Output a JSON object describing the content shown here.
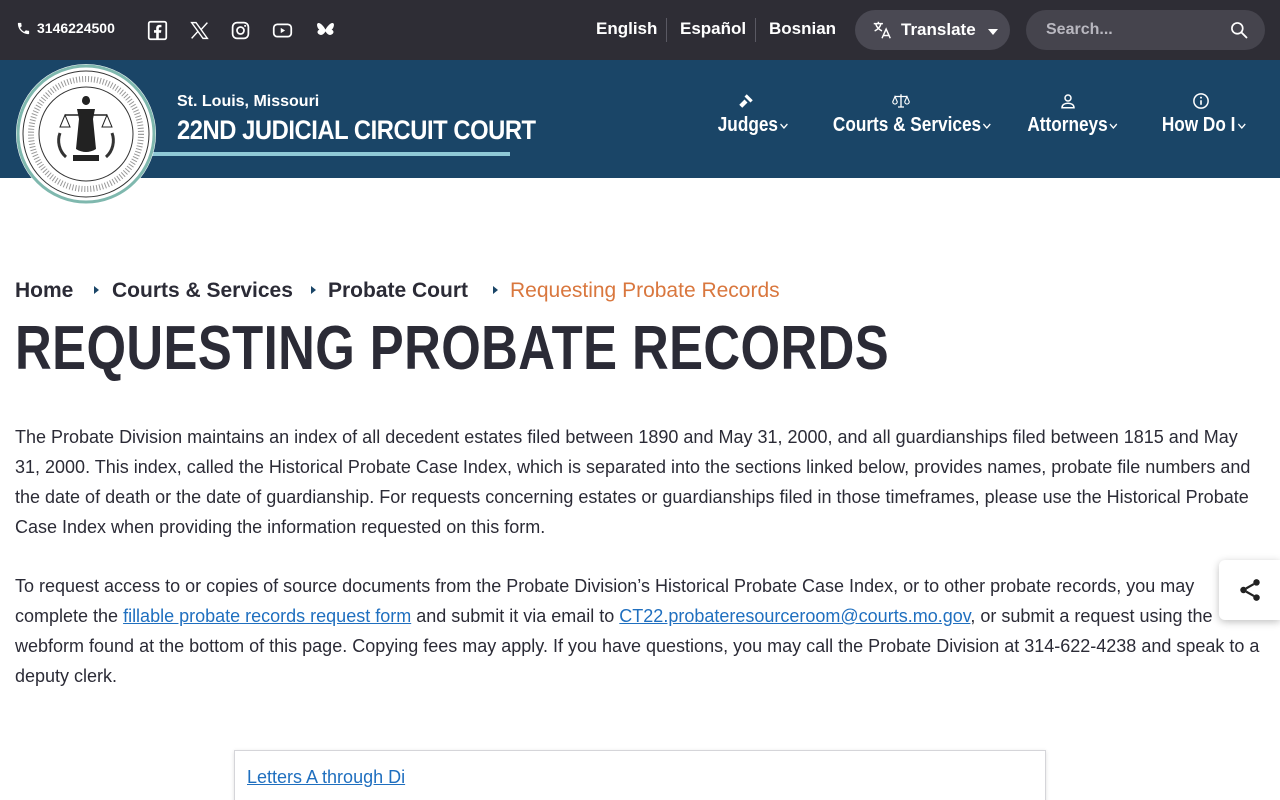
{
  "topbar": {
    "phone": "3146224500",
    "social": [
      "facebook-icon",
      "x-icon",
      "instagram-icon",
      "youtube-icon",
      "bluesky-icon"
    ],
    "languages": [
      "English",
      "Español",
      "Bosnian"
    ],
    "translate_label": "Translate",
    "search_placeholder": "Search..."
  },
  "header": {
    "location": "St. Louis, Missouri",
    "court_name": "22ND JUDICIAL CIRCUIT COURT",
    "nav": [
      {
        "label": "Judges",
        "icon": "gavel-icon"
      },
      {
        "label": "Courts & Services",
        "icon": "scales-icon"
      },
      {
        "label": "Attorneys",
        "icon": "person-icon"
      },
      {
        "label": "How Do I",
        "icon": "info-icon"
      }
    ]
  },
  "breadcrumb": [
    "Home",
    "Courts & Services",
    "Probate Court",
    "Requesting Probate Records"
  ],
  "page_title": "REQUESTING PROBATE RECORDS",
  "body": {
    "p1": "The Probate Division maintains an index of all decedent estates filed between 1890 and May 31, 2000, and all guardianships filed between 1815 and May 31, 2000. This index, called the Historical Probate Case Index, which is separated into the sections linked below, provides names, probate file numbers and the date of death or the date of guardianship.  For requests concerning estates or guardianships filed in those timeframes, please use the Historical Probate Case Index when providing the information requested on this form.",
    "p2_a": "To request access to or copies of source documents from the Probate Division’s Historical Probate Case Index, or to other probate records, you may complete the ",
    "p2_link1": "fillable probate records request form",
    "p2_b": " and submit it via email to ",
    "p2_link2": "CT22.probateresourceroom@courts.mo.gov",
    "p2_c": ", or submit a request using the webform found at the bottom of this page. Copying fees may apply. If you have questions, you may call the Probate Division at 314-622-4238 and speak to a deputy clerk."
  },
  "index_links": [
    "Letters A through Di"
  ],
  "colors": {
    "topbar": "#2e2d35",
    "header": "#1a4567",
    "accent": "#d9773e",
    "link": "#1f6fbf"
  }
}
